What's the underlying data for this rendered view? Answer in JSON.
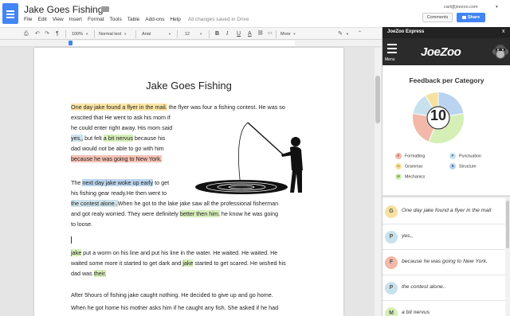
{
  "document": {
    "title": "Jake Goes Fishing",
    "menu": [
      "File",
      "Edit",
      "View",
      "Insert",
      "Format",
      "Tools",
      "Table",
      "Add-ons",
      "Help"
    ],
    "save_status": "All changes saved in Drive",
    "user_email": "carl@joezoo.com",
    "comments_label": "Comments",
    "share_label": "Share"
  },
  "toolbar": {
    "zoom": "100%",
    "style": "Normal text",
    "font": "Arial",
    "size": "12",
    "more": "More",
    "bold": "B",
    "italic": "I",
    "underline": "U",
    "text_color": "A"
  },
  "page": {
    "title": "Jake Goes Fishing",
    "p1": {
      "s1": "One day jake found a flyer in the mail.",
      "s2": " the flyer was four a fishing contest. He was so",
      "l2": "exscited that He went to ask his mom if",
      "l3": "he could enter right away. His mom said",
      "l4a": "yes,,",
      "l4b": " but felt ",
      "l4c": "a bit nervus",
      "l4d": " because his",
      "l5": "dad would not be able to go with him",
      "l6": "because he was going to New York."
    },
    "p2": {
      "l1a": "The ",
      "l1b": "next day jake woke up early",
      "l1c": " to get",
      "l2": "his fishing gear ready.He then went to",
      "l3a": "the contest alone..",
      "l3b": "When he got to the lake jake saw all the professional fisherman",
      "l4a": "and got realy worried.  They were definitely ",
      "l4b": "better then him.",
      "l4c": "  he know he was going",
      "l5": "to loose."
    },
    "p3": {
      "l1a": "jake",
      "l1b": " put a worm on his line and put his line in the water. He waited. He waited. He",
      "l2a": "waited some more it started to get dark and ",
      "l2b": "jake",
      "l2c": " started to get scared. He wished his",
      "l3a": "dad was ",
      "l3b": "their."
    },
    "p4": {
      "l1": "After 5hours of fishing jake caught nothing.  He decided to give up and go home.",
      "l2": "When he got home his mother asks him if he caught any fish.  She asked if he had"
    }
  },
  "sidebar": {
    "title": "JoeZoo Express",
    "close": "x",
    "menu_label": "Menu",
    "logo": "JoeZoo",
    "feedback_title": "Feedback per Category",
    "score": "10",
    "legend": [
      {
        "letter": "F",
        "label": "Formatting",
        "color": "#f2b8a8"
      },
      {
        "letter": "P",
        "label": "Punctuation",
        "color": "#c8e1ec"
      },
      {
        "letter": "G",
        "label": "Grammar",
        "color": "#f7e1a1"
      },
      {
        "letter": "S",
        "label": "Structure",
        "color": "#b9d3f0"
      },
      {
        "letter": "M",
        "label": "Mechanics",
        "color": "#d5efb6"
      }
    ],
    "items": [
      {
        "letter": "G",
        "text": "One day jake found a flyer in the mail",
        "color": "#f7e1a1"
      },
      {
        "letter": "P",
        "text": "yes,,",
        "color": "#c8e1ec"
      },
      {
        "letter": "F",
        "text": "because he was going to New York.",
        "color": "#f2b8a8"
      },
      {
        "letter": "P",
        "text": "the contest alone..",
        "color": "#c8e1ec"
      },
      {
        "letter": "M",
        "text": "a bit nervus",
        "color": "#d5efb6"
      }
    ]
  }
}
